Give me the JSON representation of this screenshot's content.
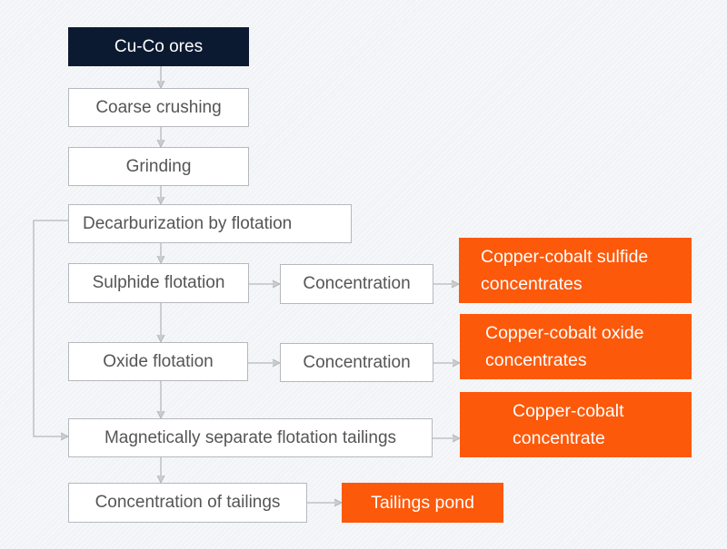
{
  "colors": {
    "ore": "#0c1a31",
    "product": "#fc590b",
    "line": "#b5b8bd"
  },
  "nodes": {
    "ores": "Cu-Co ores",
    "coarse_crushing": "Coarse crushing",
    "grinding": "Grinding",
    "decarburization": "Decarburization by flotation",
    "sulphide_flotation": "Sulphide flotation",
    "concentration_1": "Concentration",
    "sulfide_concentrates_1": "Copper-cobalt sulfide",
    "sulfide_concentrates_2": "concentrates",
    "oxide_flotation": "Oxide flotation",
    "concentration_2": "Concentration",
    "oxide_concentrates_1": "Copper-cobalt oxide",
    "oxide_concentrates_2": "concentrates",
    "magnetic_separation": "Magnetically separate flotation tailings",
    "cobalt_concentrate_1": "Copper-cobalt",
    "cobalt_concentrate_2": "concentrate",
    "tailings_concentration": "Concentration of tailings",
    "tailings_pond": "Tailings pond"
  }
}
